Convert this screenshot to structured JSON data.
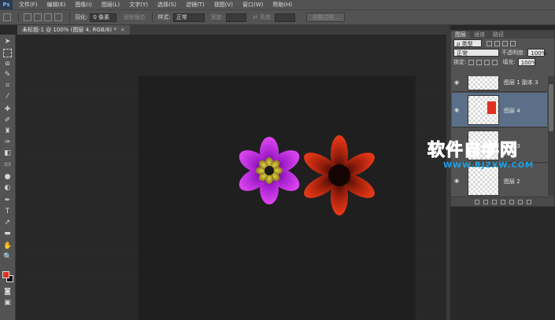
{
  "app": {
    "logo": "Ps"
  },
  "menu": [
    "文件(F)",
    "编辑(E)",
    "图像(I)",
    "图层(L)",
    "文字(Y)",
    "选择(S)",
    "滤镜(T)",
    "视图(V)",
    "窗口(W)",
    "帮助(H)"
  ],
  "options": {
    "feather_label": "羽化:",
    "feather_value": "0 像素",
    "antialias_label": "消除锯齿",
    "style_label": "样式:",
    "style_value": "正常",
    "width_label": "宽度:",
    "height_label": "高度:",
    "refine_edge": "调整边缘..."
  },
  "document": {
    "tab_label": "未标题-1 @ 100% (图层 4, RGB/8) *",
    "close": "×"
  },
  "colors": {
    "foreground": "#e0301e",
    "background": "#111111",
    "accent_watermark": "#1aa3e8"
  },
  "layers_panel": {
    "tabs": [
      "图层",
      "通道",
      "路径"
    ],
    "filter_kind": "ρ 类型",
    "blend_mode": "正常",
    "opacity_label": "不透明度:",
    "opacity_value": "100%",
    "lock_label": "锁定:",
    "fill_label": "填充:",
    "fill_value": "100%",
    "layers": [
      {
        "name": "图层 1 副本 3",
        "selected": false
      },
      {
        "name": "图层 4",
        "selected": true
      },
      {
        "name": "图层 3",
        "selected": false
      },
      {
        "name": "图层 2",
        "selected": false
      }
    ]
  },
  "watermark": {
    "title": "软件自学网",
    "url": "WWW.RJZXW.COM"
  }
}
